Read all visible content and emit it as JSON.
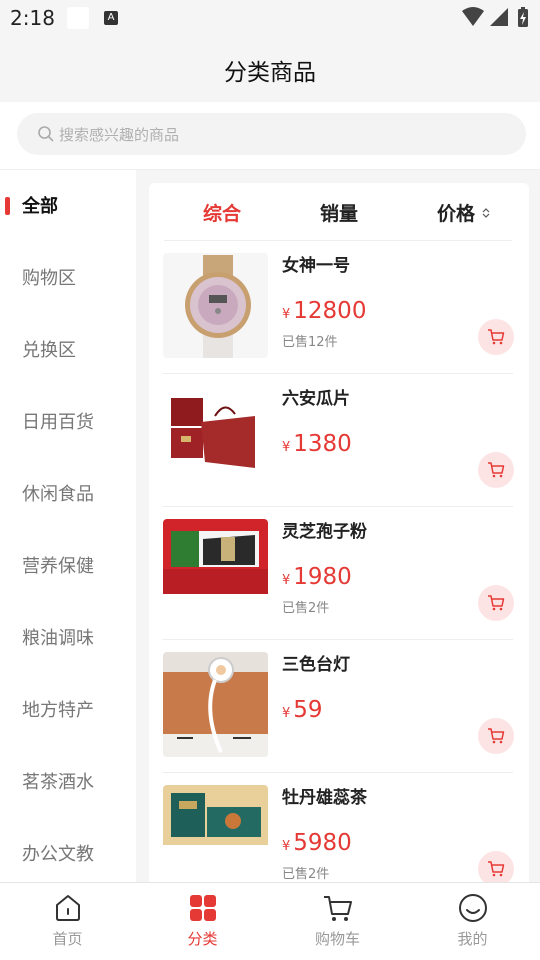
{
  "status_bar": {
    "time": "2:18",
    "notification_letter": "A"
  },
  "header": {
    "title": "分类商品"
  },
  "search": {
    "placeholder": "搜索感兴趣的商品"
  },
  "sidebar": {
    "items": [
      {
        "label": "全部",
        "active": true
      },
      {
        "label": "购物区"
      },
      {
        "label": "兑换区"
      },
      {
        "label": "日用百货"
      },
      {
        "label": "休闲食品"
      },
      {
        "label": "营养保健"
      },
      {
        "label": "粮油调味"
      },
      {
        "label": "地方特产"
      },
      {
        "label": "茗茶酒水"
      },
      {
        "label": "办公文教"
      }
    ]
  },
  "sort_tabs": {
    "comprehensive": "综合",
    "sales": "销量",
    "price": "价格"
  },
  "products": [
    {
      "name": "女神一号",
      "currency": "¥",
      "price": "12800",
      "sold": "已售12件",
      "image": "watch"
    },
    {
      "name": "六安瓜片",
      "currency": "¥",
      "price": "1380",
      "sold": "",
      "image": "tea-gift-box"
    },
    {
      "name": "灵芝孢子粉",
      "currency": "¥",
      "price": "1980",
      "sold": "已售2件",
      "image": "red-box"
    },
    {
      "name": "三色台灯",
      "currency": "¥",
      "price": "59",
      "sold": "",
      "image": "lamp"
    },
    {
      "name": "牡丹雄蕊茶",
      "currency": "¥",
      "price": "5980",
      "sold": "已售2件",
      "image": "green-tea-box"
    }
  ],
  "tabbar": {
    "home": "首页",
    "category": "分类",
    "cart": "购物车",
    "mine": "我的"
  },
  "colors": {
    "accent": "#e53935",
    "cart_bg": "#fde4e4",
    "background": "#f5f5f5"
  }
}
